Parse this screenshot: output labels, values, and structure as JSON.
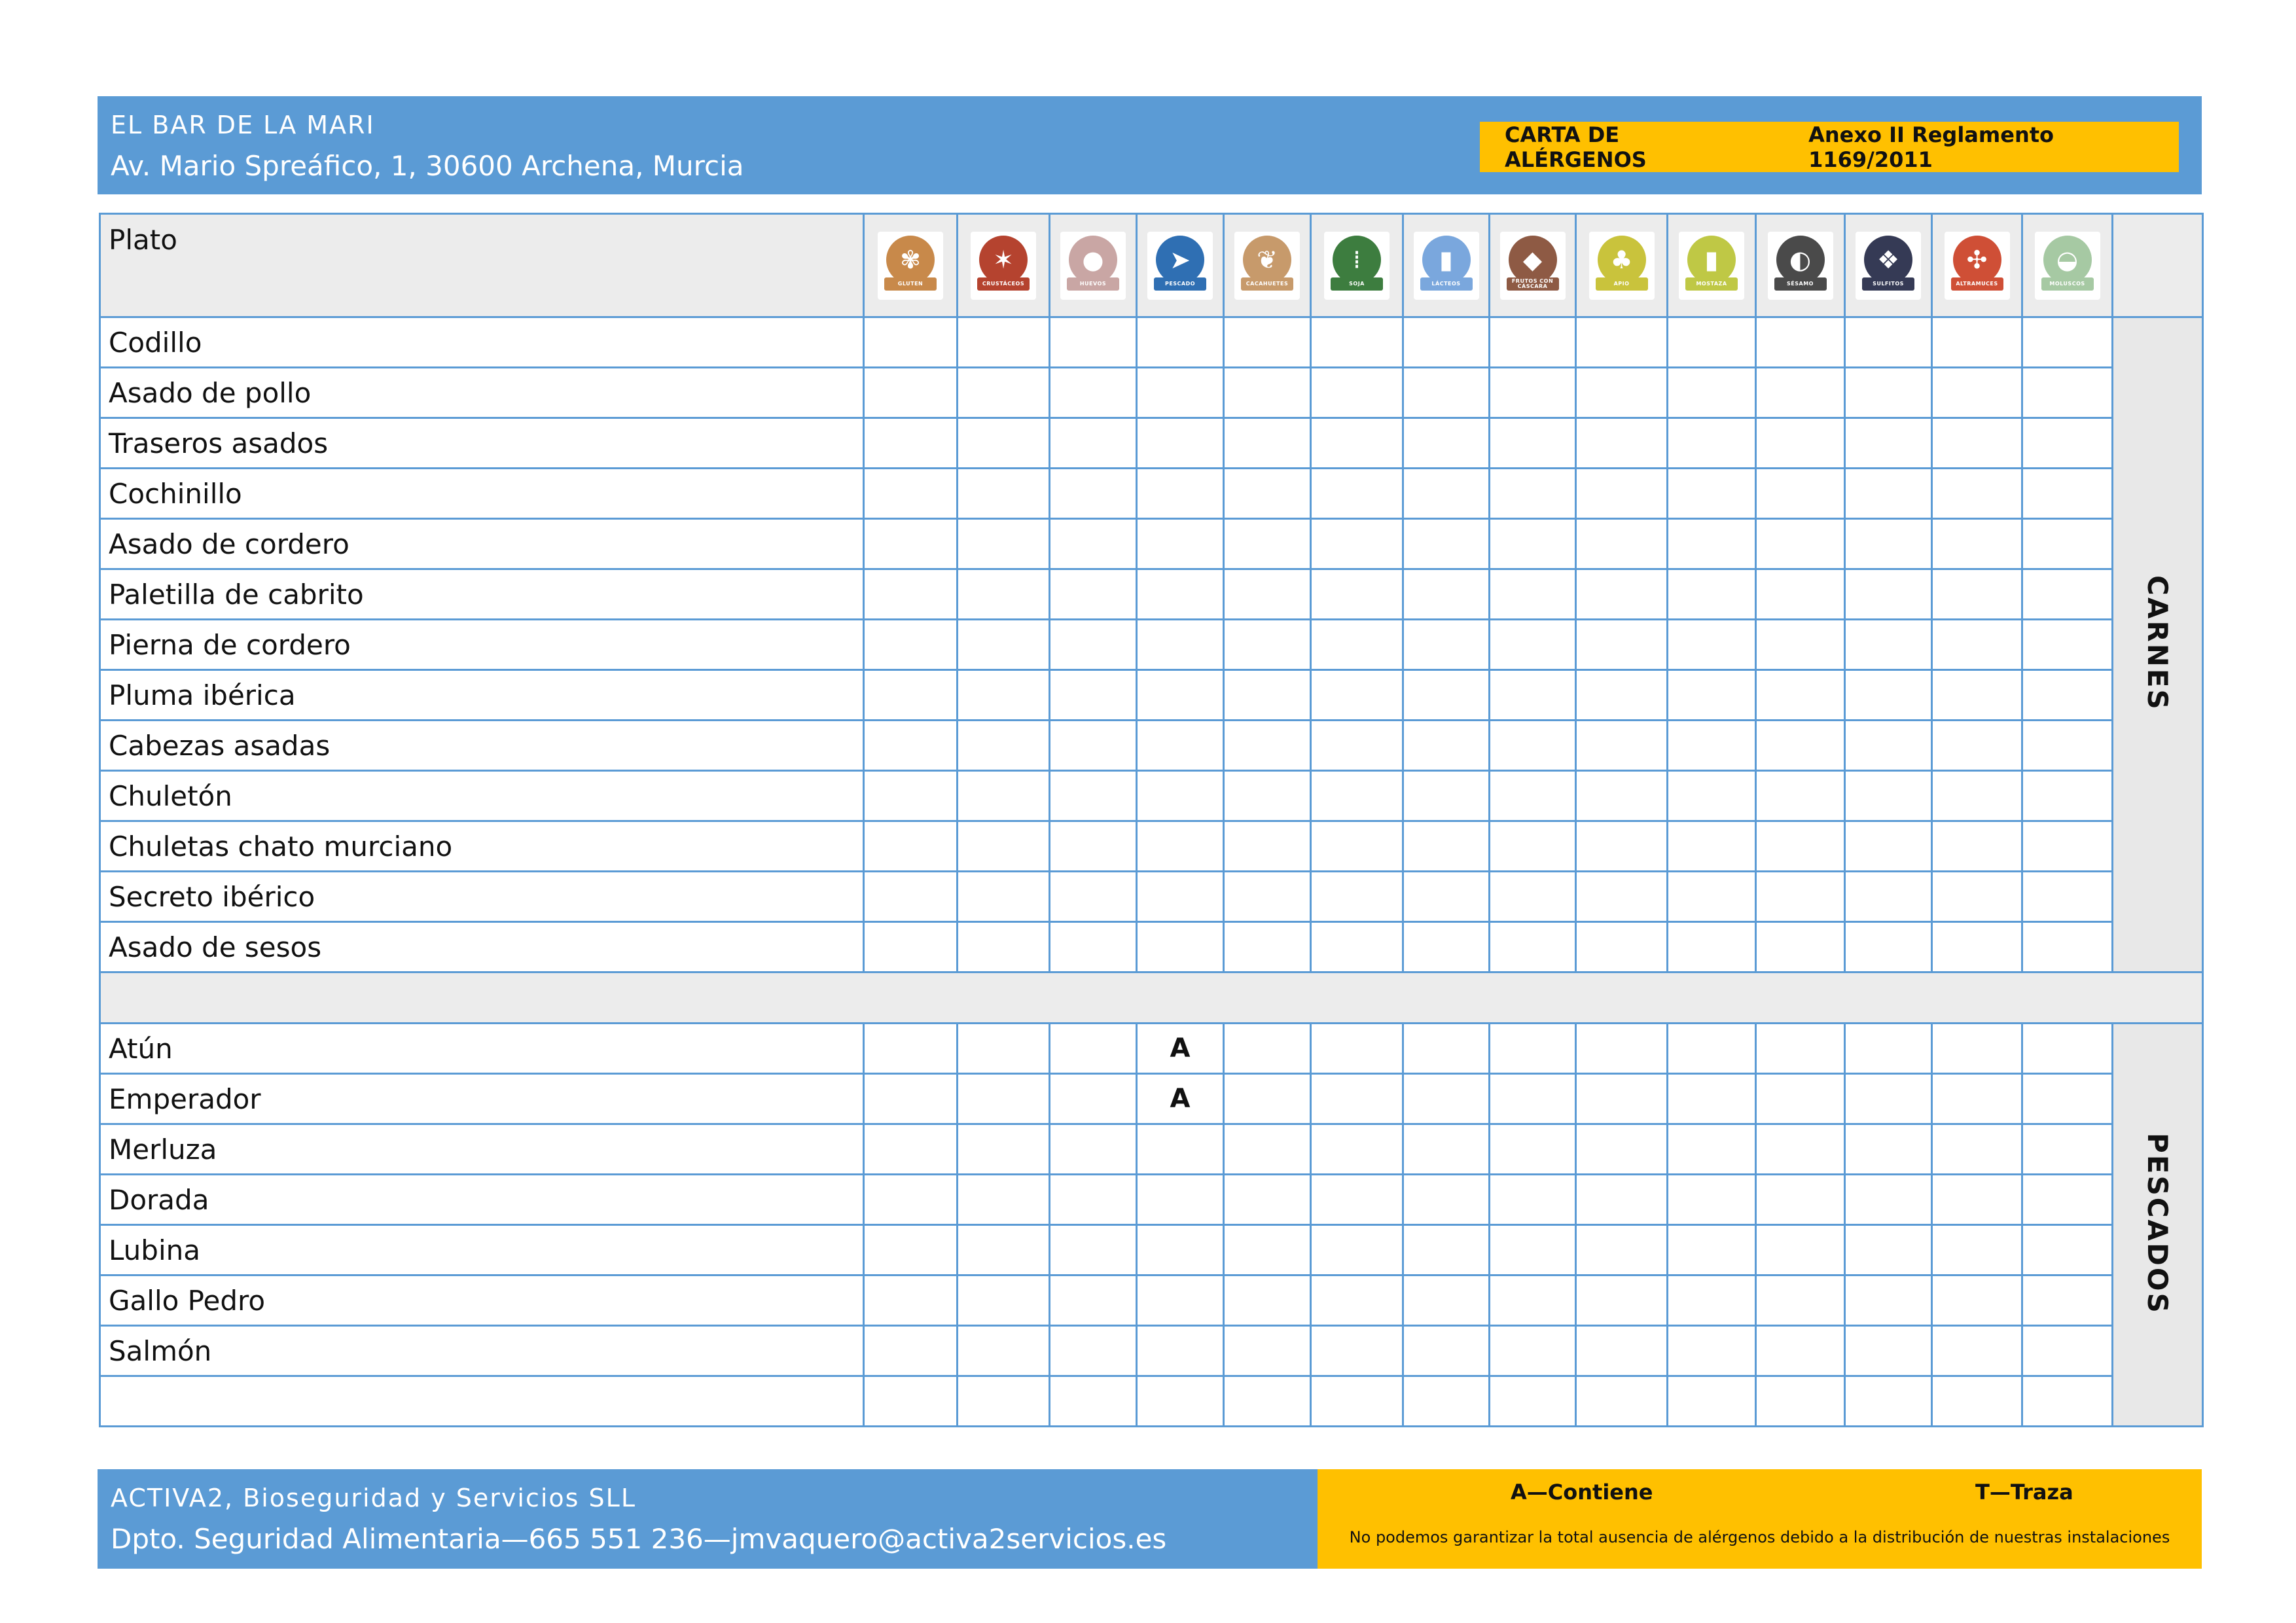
{
  "header": {
    "org_name": "EL BAR DE LA MARI",
    "address": "Av. Mario Spreáfico, 1, 30600 Archena, Murcia",
    "badge_title": "CARTA DE ALÉRGENOS",
    "badge_regulation": "Anexo II Reglamento 1169/2011"
  },
  "table": {
    "dish_header": "Plato",
    "allergens": [
      {
        "label": "GLUTEN",
        "icon": "wheat-icon",
        "glyph": "✾",
        "color": "#c8894a"
      },
      {
        "label": "CRUSTÁCEOS",
        "icon": "lobster-icon",
        "glyph": "✶",
        "color": "#b5432f"
      },
      {
        "label": "HUEVOS",
        "icon": "egg-icon",
        "glyph": "●",
        "color": "#c9a6a4"
      },
      {
        "label": "PESCADO",
        "icon": "fish-icon",
        "glyph": "➤",
        "color": "#2f6fb3"
      },
      {
        "label": "CACAHUETES",
        "icon": "peanut-icon",
        "glyph": "❦",
        "color": "#c79a6b"
      },
      {
        "label": "SOJA",
        "icon": "soy-icon",
        "glyph": "⁞",
        "color": "#3d7d3f"
      },
      {
        "label": "LÁCTEOS",
        "icon": "milk-icon",
        "glyph": "▮",
        "color": "#7aa7dd"
      },
      {
        "label": "FRUTOS CON CÁSCARA",
        "icon": "nut-icon",
        "glyph": "◆",
        "color": "#8e5a44"
      },
      {
        "label": "APIO",
        "icon": "celery-icon",
        "glyph": "♣",
        "color": "#c9c33c"
      },
      {
        "label": "MOSTAZA",
        "icon": "mustard-icon",
        "glyph": "▮",
        "color": "#bfc845"
      },
      {
        "label": "SÉSAMO",
        "icon": "sesame-icon",
        "glyph": "◐",
        "color": "#4a4a4a"
      },
      {
        "label": "SULFITOS",
        "icon": "sulfite-icon",
        "glyph": "❖",
        "color": "#353a55"
      },
      {
        "label": "ALTRAMUCES",
        "icon": "lupin-icon",
        "glyph": "✣",
        "color": "#cf4f36"
      },
      {
        "label": "MOLUSCOS",
        "icon": "shell-icon",
        "glyph": "◒",
        "color": "#a6c9a3"
      }
    ],
    "sections": [
      {
        "name": "CARNES",
        "dishes": [
          {
            "name": "Codillo",
            "marks": [
              "",
              "",
              "",
              "",
              "",
              "",
              "",
              "",
              "",
              "",
              "",
              "",
              "",
              ""
            ]
          },
          {
            "name": "Asado de pollo",
            "marks": [
              "",
              "",
              "",
              "",
              "",
              "",
              "",
              "",
              "",
              "",
              "",
              "",
              "",
              ""
            ]
          },
          {
            "name": "Traseros asados",
            "marks": [
              "",
              "",
              "",
              "",
              "",
              "",
              "",
              "",
              "",
              "",
              "",
              "",
              "",
              ""
            ]
          },
          {
            "name": "Cochinillo",
            "marks": [
              "",
              "",
              "",
              "",
              "",
              "",
              "",
              "",
              "",
              "",
              "",
              "",
              "",
              ""
            ]
          },
          {
            "name": "Asado de cordero",
            "marks": [
              "",
              "",
              "",
              "",
              "",
              "",
              "",
              "",
              "",
              "",
              "",
              "",
              "",
              ""
            ]
          },
          {
            "name": "Paletilla de cabrito",
            "marks": [
              "",
              "",
              "",
              "",
              "",
              "",
              "",
              "",
              "",
              "",
              "",
              "",
              "",
              ""
            ]
          },
          {
            "name": "Pierna de cordero",
            "marks": [
              "",
              "",
              "",
              "",
              "",
              "",
              "",
              "",
              "",
              "",
              "",
              "",
              "",
              ""
            ]
          },
          {
            "name": "Pluma ibérica",
            "marks": [
              "",
              "",
              "",
              "",
              "",
              "",
              "",
              "",
              "",
              "",
              "",
              "",
              "",
              ""
            ]
          },
          {
            "name": "Cabezas asadas",
            "marks": [
              "",
              "",
              "",
              "",
              "",
              "",
              "",
              "",
              "",
              "",
              "",
              "",
              "",
              ""
            ]
          },
          {
            "name": "Chuletón",
            "marks": [
              "",
              "",
              "",
              "",
              "",
              "",
              "",
              "",
              "",
              "",
              "",
              "",
              "",
              ""
            ]
          },
          {
            "name": "Chuletas chato murciano",
            "marks": [
              "",
              "",
              "",
              "",
              "",
              "",
              "",
              "",
              "",
              "",
              "",
              "",
              "",
              ""
            ]
          },
          {
            "name": "Secreto ibérico",
            "marks": [
              "",
              "",
              "",
              "",
              "",
              "",
              "",
              "",
              "",
              "",
              "",
              "",
              "",
              ""
            ]
          },
          {
            "name": "Asado de sesos",
            "marks": [
              "",
              "",
              "",
              "",
              "",
              "",
              "",
              "",
              "",
              "",
              "",
              "",
              "",
              ""
            ]
          }
        ]
      },
      {
        "name": "PESCADOS",
        "dishes": [
          {
            "name": "Atún",
            "marks": [
              "",
              "",
              "",
              "A",
              "",
              "",
              "",
              "",
              "",
              "",
              "",
              "",
              "",
              ""
            ]
          },
          {
            "name": "Emperador",
            "marks": [
              "",
              "",
              "",
              "A",
              "",
              "",
              "",
              "",
              "",
              "",
              "",
              "",
              "",
              ""
            ]
          },
          {
            "name": "Merluza",
            "marks": [
              "",
              "",
              "",
              "",
              "",
              "",
              "",
              "",
              "",
              "",
              "",
              "",
              "",
              ""
            ]
          },
          {
            "name": "Dorada",
            "marks": [
              "",
              "",
              "",
              "",
              "",
              "",
              "",
              "",
              "",
              "",
              "",
              "",
              "",
              ""
            ]
          },
          {
            "name": "Lubina",
            "marks": [
              "",
              "",
              "",
              "",
              "",
              "",
              "",
              "",
              "",
              "",
              "",
              "",
              "",
              ""
            ]
          },
          {
            "name": "Gallo Pedro",
            "marks": [
              "",
              "",
              "",
              "",
              "",
              "",
              "",
              "",
              "",
              "",
              "",
              "",
              "",
              ""
            ]
          },
          {
            "name": "Salmón",
            "marks": [
              "",
              "",
              "",
              "",
              "",
              "",
              "",
              "",
              "",
              "",
              "",
              "",
              "",
              ""
            ]
          },
          {
            "name": "",
            "marks": [
              "",
              "",
              "",
              "",
              "",
              "",
              "",
              "",
              "",
              "",
              "",
              "",
              "",
              ""
            ]
          }
        ]
      }
    ]
  },
  "footer": {
    "company": "ACTIVA2, Bioseguridad y Servicios SLL",
    "department": "Dpto. Seguridad Alimentaria—665 551 236—jmvaquero@activa2servicios.es",
    "legend_contains": "A—Contiene",
    "legend_trace": "T—Traza",
    "disclaimer": "No podemos garantizar la total ausencia de alérgenos debido a la distribución de nuestras instalaciones"
  }
}
